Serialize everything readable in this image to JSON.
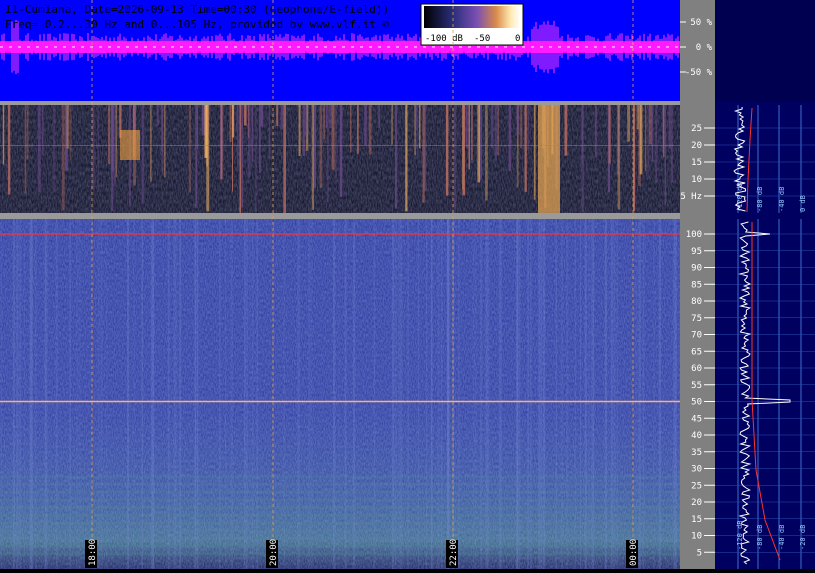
{
  "header": {
    "line1": "I1-Cumiana, Date=2026-09-13 Time=00:30 (Geophone/E-field))",
    "line2": "Freq= 0.2...30 Hz and 0...105 Hz, provided by www.vlf.it ©"
  },
  "colorbar": {
    "labels": [
      "-100 dB",
      "-50",
      "0"
    ],
    "colors": [
      "#000000",
      "#2a2e7a",
      "#7a4fb3",
      "#d98a4a",
      "#ffe9b0",
      "#ffffff"
    ]
  },
  "waveform": {
    "axis_labels": [
      "50 %",
      "0 %",
      "-50 %"
    ],
    "background": "#0000ff",
    "trace_color": "#ff00ff"
  },
  "spectrogram_low": {
    "axis_labels": [
      "25",
      "20",
      "15",
      "10",
      "5 Hz"
    ]
  },
  "spectrogram_high": {
    "axis_labels": [
      "100",
      "95",
      "90",
      "85",
      "80",
      "75",
      "70",
      "65",
      "60",
      "55",
      "50",
      "45",
      "40",
      "35",
      "30",
      "25",
      "20",
      "15",
      "10",
      "5"
    ],
    "hum_line_color": "#ff3030"
  },
  "time_axis": {
    "labels": [
      "18:00",
      "20:00",
      "22:00",
      "00:00"
    ]
  },
  "side_panel_low": {
    "db_labels": [
      "-120 dB",
      "-80 dB",
      "-40 dB",
      "0 dB"
    ]
  },
  "side_panel_high": {
    "db_labels": [
      "-120 dB",
      "-80 dB",
      "-40 dB",
      "-20 dB"
    ]
  },
  "chart_data": {
    "type": "heatmap",
    "title": "I1-Cumiana, Date=2026-09-13 Time=00:30 (Geophone/E-field))",
    "subtitle": "Freq= 0.2...30 Hz and 0...105 Hz, provided by www.vlf.it ©",
    "x_ticks": [
      "18:00",
      "20:00",
      "22:00",
      "00:00"
    ],
    "y_low_ticks_hz": [
      5,
      10,
      15,
      20,
      25
    ],
    "y_low_range_hz": [
      0.2,
      30
    ],
    "y_high_ticks_hz": [
      5,
      10,
      15,
      20,
      25,
      30,
      35,
      40,
      45,
      50,
      55,
      60,
      65,
      70,
      75,
      80,
      85,
      90,
      95,
      100
    ],
    "y_high_range_hz": [
      0,
      105
    ],
    "colorbar_db": [
      -100,
      -50,
      0
    ],
    "waveform_ticks_percent": [
      50,
      0,
      -50
    ],
    "hum_lines_hz": [
      50,
      100
    ]
  }
}
